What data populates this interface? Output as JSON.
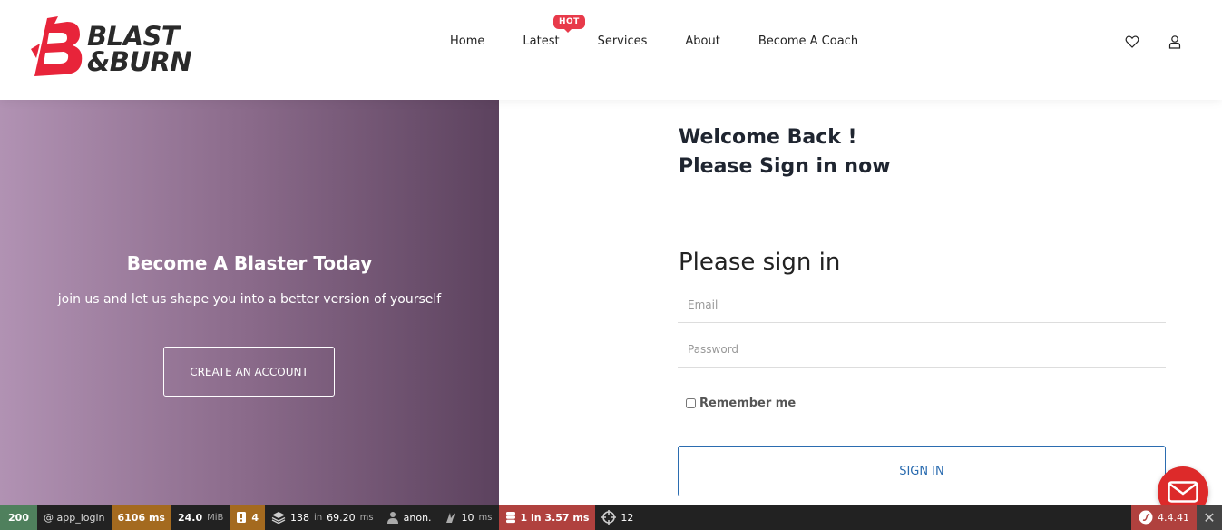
{
  "brand": {
    "logo_line1": "BLAST",
    "logo_line2": "&BURN",
    "accent_color": "#e8243a"
  },
  "nav": {
    "items": [
      {
        "label": "Home"
      },
      {
        "label": "Latest"
      },
      {
        "label": "Services"
      },
      {
        "label": "About"
      },
      {
        "label": "Become A Coach"
      }
    ],
    "hot_badge": "HOT"
  },
  "header_icons": [
    "heart-icon",
    "user-icon"
  ],
  "promo": {
    "title": "Become A Blaster Today",
    "subtitle": "join us and let us shape you into a better version of yourself",
    "button_label": "CREATE AN ACCOUNT",
    "gradient": [
      "#b192b3",
      "#5c425e"
    ]
  },
  "login": {
    "welcome_line1": "Welcome Back !",
    "welcome_line2": "Please Sign in now",
    "heading": "Please sign in",
    "email_placeholder": "Email",
    "password_placeholder": "Password",
    "remember_label": "Remember me",
    "submit_label": "SIGN IN",
    "button_color": "#2b6cb0"
  },
  "toolbar": {
    "status": "200",
    "route": "@ app_login",
    "time": "6106 ms",
    "memory_value": "24.0",
    "memory_unit": "MiB",
    "warnings": "4",
    "twig_count": "138",
    "twig_in": "in",
    "twig_time": "69.20",
    "twig_unit": "ms",
    "user": "anon.",
    "perf_value": "10",
    "perf_unit": "ms",
    "db_queries": "1 in 3.57 ms",
    "translations": "12",
    "symfony_version": "4.4.41"
  }
}
